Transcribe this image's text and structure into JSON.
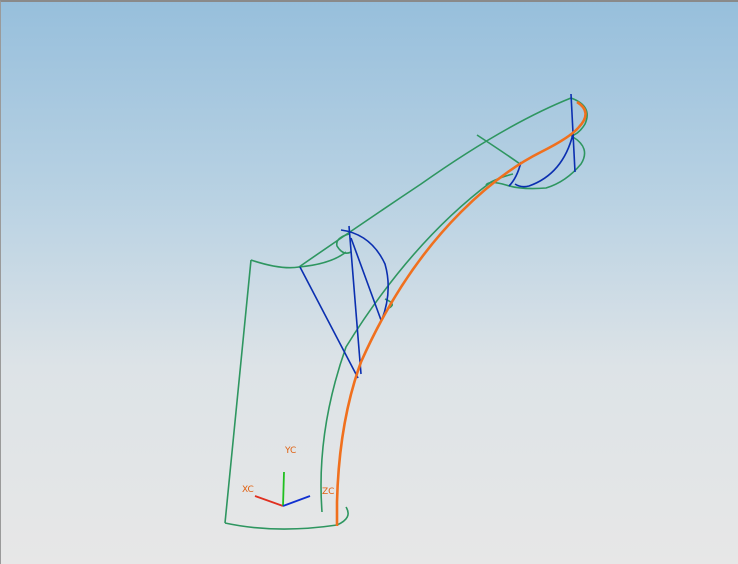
{
  "colors": {
    "wireframe": "#2e9660",
    "section_curves": "#0b2fb0",
    "guide_curve": "#f0701e",
    "axis_x": "#e03020",
    "axis_y": "#20c020",
    "axis_z": "#1030d0",
    "axis_label": "#e06010"
  },
  "triad": {
    "x_label": "XC",
    "y_label": "YC",
    "z_label": "ZC"
  }
}
